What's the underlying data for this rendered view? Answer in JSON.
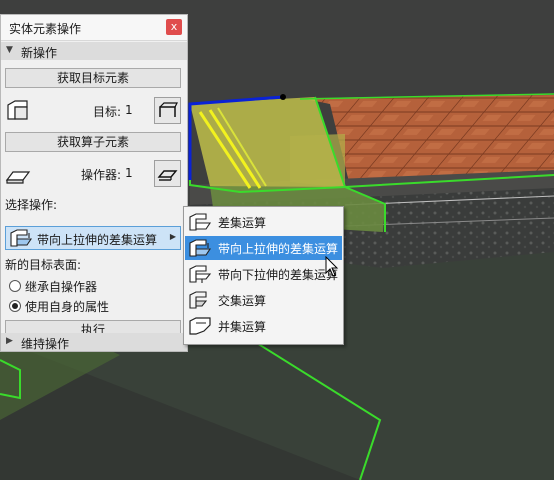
{
  "palette": {
    "title": "实体元素操作",
    "close_glyph": "x",
    "section_new_ops": "新操作",
    "get_target_button": "获取目标元素",
    "target_label": "目标:",
    "target_count": "1",
    "get_operator_button": "获取算子元素",
    "operator_label": "操作器:",
    "operator_count": "1",
    "choose_op_label": "选择操作:",
    "selected_operation": "带向上拉伸的差集运算",
    "new_target_surface_label": "新的目标表面:",
    "radio_inherit": "继承自操作器",
    "radio_own": "使用自身的属性",
    "radio_selected": "radio_own",
    "execute_button": "执行",
    "section_keep_ops": "维持操作"
  },
  "dropdown": {
    "items": [
      {
        "label": "差集运算",
        "icon": "subtraction-icon"
      },
      {
        "label": "带向上拉伸的差集运算",
        "icon": "subtraction-upward-icon"
      },
      {
        "label": "带向下拉伸的差集运算",
        "icon": "subtraction-downward-icon"
      },
      {
        "label": "交集运算",
        "icon": "intersection-icon"
      },
      {
        "label": "并集运算",
        "icon": "union-icon"
      }
    ],
    "highlighted_index": 1
  },
  "colors": {
    "highlight": "#3c8fe0",
    "close": "#e04d4d",
    "selection_green": "#3adb2b",
    "edge_blue": "#0a22d6"
  }
}
